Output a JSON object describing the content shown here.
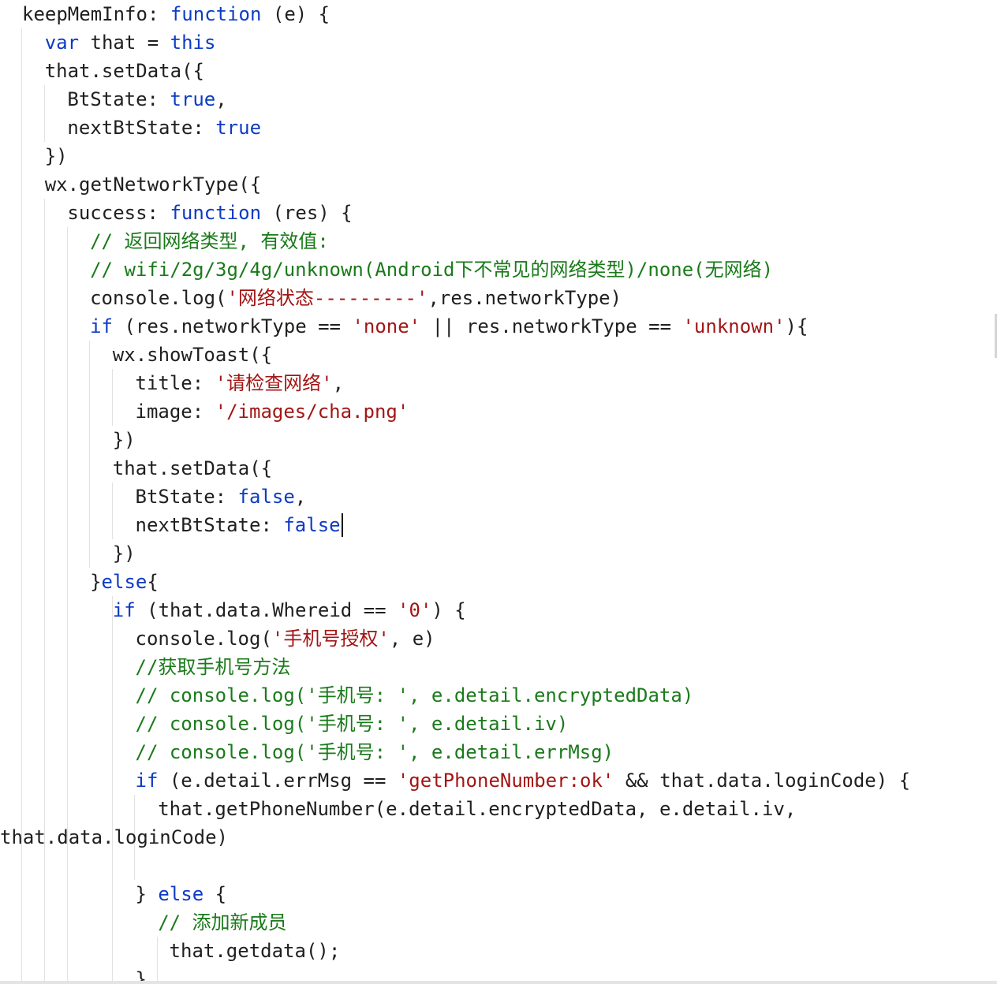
{
  "editor": {
    "lines": [
      {
        "indent": 1,
        "tokens": [
          [
            "p",
            "keepMemInfo: "
          ],
          [
            "k",
            "function"
          ],
          [
            "p",
            " (e) {"
          ]
        ]
      },
      {
        "indent": 2,
        "tokens": [
          [
            "k",
            "var"
          ],
          [
            "p",
            " that = "
          ],
          [
            "k",
            "this"
          ]
        ]
      },
      {
        "indent": 2,
        "tokens": [
          [
            "p",
            "that.setData({"
          ]
        ]
      },
      {
        "indent": 3,
        "tokens": [
          [
            "p",
            "BtState: "
          ],
          [
            "k",
            "true"
          ],
          [
            "p",
            ","
          ]
        ]
      },
      {
        "indent": 3,
        "tokens": [
          [
            "p",
            "nextBtState: "
          ],
          [
            "k",
            "true"
          ]
        ]
      },
      {
        "indent": 2,
        "tokens": [
          [
            "p",
            "})"
          ]
        ]
      },
      {
        "indent": 2,
        "tokens": [
          [
            "p",
            "wx.getNetworkType({"
          ]
        ]
      },
      {
        "indent": 3,
        "tokens": [
          [
            "p",
            "success: "
          ],
          [
            "k",
            "function"
          ],
          [
            "p",
            " (res) {"
          ]
        ]
      },
      {
        "indent": 4,
        "tokens": [
          [
            "c",
            "// 返回网络类型, 有效值:"
          ]
        ]
      },
      {
        "indent": 4,
        "tokens": [
          [
            "c",
            "// wifi/2g/3g/4g/unknown(Android下不常见的网络类型)/none(无网络)"
          ]
        ]
      },
      {
        "indent": 4,
        "tokens": [
          [
            "p",
            "console.log("
          ],
          [
            "s",
            "'网络状态---------'"
          ],
          [
            "p",
            ",res.networkType)"
          ]
        ]
      },
      {
        "indent": 4,
        "tokens": [
          [
            "k",
            "if"
          ],
          [
            "p",
            " (res.networkType == "
          ],
          [
            "s",
            "'none'"
          ],
          [
            "p",
            " || res.networkType == "
          ],
          [
            "s",
            "'unknown'"
          ],
          [
            "p",
            "){"
          ]
        ]
      },
      {
        "indent": 5,
        "tokens": [
          [
            "p",
            "wx.showToast({"
          ]
        ]
      },
      {
        "indent": 6,
        "tokens": [
          [
            "p",
            "title: "
          ],
          [
            "s",
            "'请检查网络'"
          ],
          [
            "p",
            ","
          ]
        ]
      },
      {
        "indent": 6,
        "tokens": [
          [
            "p",
            "image: "
          ],
          [
            "s",
            "'/images/cha.png'"
          ]
        ]
      },
      {
        "indent": 5,
        "tokens": [
          [
            "p",
            "})"
          ]
        ]
      },
      {
        "indent": 5,
        "tokens": [
          [
            "p",
            "that.setData({"
          ]
        ]
      },
      {
        "indent": 6,
        "tokens": [
          [
            "p",
            "BtState: "
          ],
          [
            "k",
            "false"
          ],
          [
            "p",
            ","
          ]
        ]
      },
      {
        "indent": 6,
        "tokens": [
          [
            "p",
            "nextBtState: "
          ],
          [
            "k",
            "false"
          ]
        ]
      },
      {
        "indent": 5,
        "tokens": [
          [
            "p",
            "})"
          ]
        ]
      },
      {
        "indent": 4,
        "tokens": [
          [
            "p",
            "}"
          ],
          [
            "k",
            "else"
          ],
          [
            "p",
            "{"
          ]
        ]
      },
      {
        "indent": 5,
        "tokens": [
          [
            "k",
            "if"
          ],
          [
            "p",
            " (that.data.Whereid == "
          ],
          [
            "s",
            "'0'"
          ],
          [
            "p",
            ") {"
          ]
        ]
      },
      {
        "indent": 6,
        "tokens": [
          [
            "p",
            "console.log("
          ],
          [
            "s",
            "'手机号授权'"
          ],
          [
            "p",
            ", e)"
          ]
        ]
      },
      {
        "indent": 6,
        "tokens": [
          [
            "c",
            "//获取手机号方法"
          ]
        ]
      },
      {
        "indent": 6,
        "tokens": [
          [
            "c",
            "// console.log('手机号: ', e.detail.encryptedData)"
          ]
        ]
      },
      {
        "indent": 6,
        "tokens": [
          [
            "c",
            "// console.log('手机号: ', e.detail.iv)"
          ]
        ]
      },
      {
        "indent": 6,
        "tokens": [
          [
            "c",
            "// console.log('手机号: ', e.detail.errMsg)"
          ]
        ]
      },
      {
        "indent": 6,
        "tokens": [
          [
            "k",
            "if"
          ],
          [
            "p",
            " (e.detail.errMsg == "
          ],
          [
            "s",
            "'getPhoneNumber:ok'"
          ],
          [
            "p",
            " && that.data.loginCode) {"
          ]
        ]
      },
      {
        "indent": 7,
        "tokens": [
          [
            "p",
            "that.getPhoneNumber(e.detail.encryptedData, e.detail.iv,"
          ]
        ]
      },
      {
        "indent": 0,
        "tokens": [
          [
            "p",
            "that.data.loginCode)"
          ]
        ]
      },
      {
        "indent": 0,
        "tokens": []
      },
      {
        "indent": 6,
        "tokens": [
          [
            "p",
            "} "
          ],
          [
            "k",
            "else"
          ],
          [
            "p",
            " {"
          ]
        ]
      },
      {
        "indent": 7,
        "tokens": [
          [
            "c",
            "// 添加新成员"
          ]
        ]
      },
      {
        "indent": 7.5,
        "tokens": [
          [
            "p",
            "that.getdata();"
          ]
        ]
      },
      {
        "indent": 6,
        "tokens": [
          [
            "p",
            "}"
          ]
        ]
      }
    ]
  },
  "colors": {
    "plain": "#1f1f1f",
    "keyword": "#0d3bc4",
    "string": "#a31515",
    "comment": "#1a7a1a",
    "guide": "#e2e2e2",
    "background": "#ffffff"
  },
  "caret": {
    "line": 18,
    "after_text": "nextBtState: false"
  }
}
